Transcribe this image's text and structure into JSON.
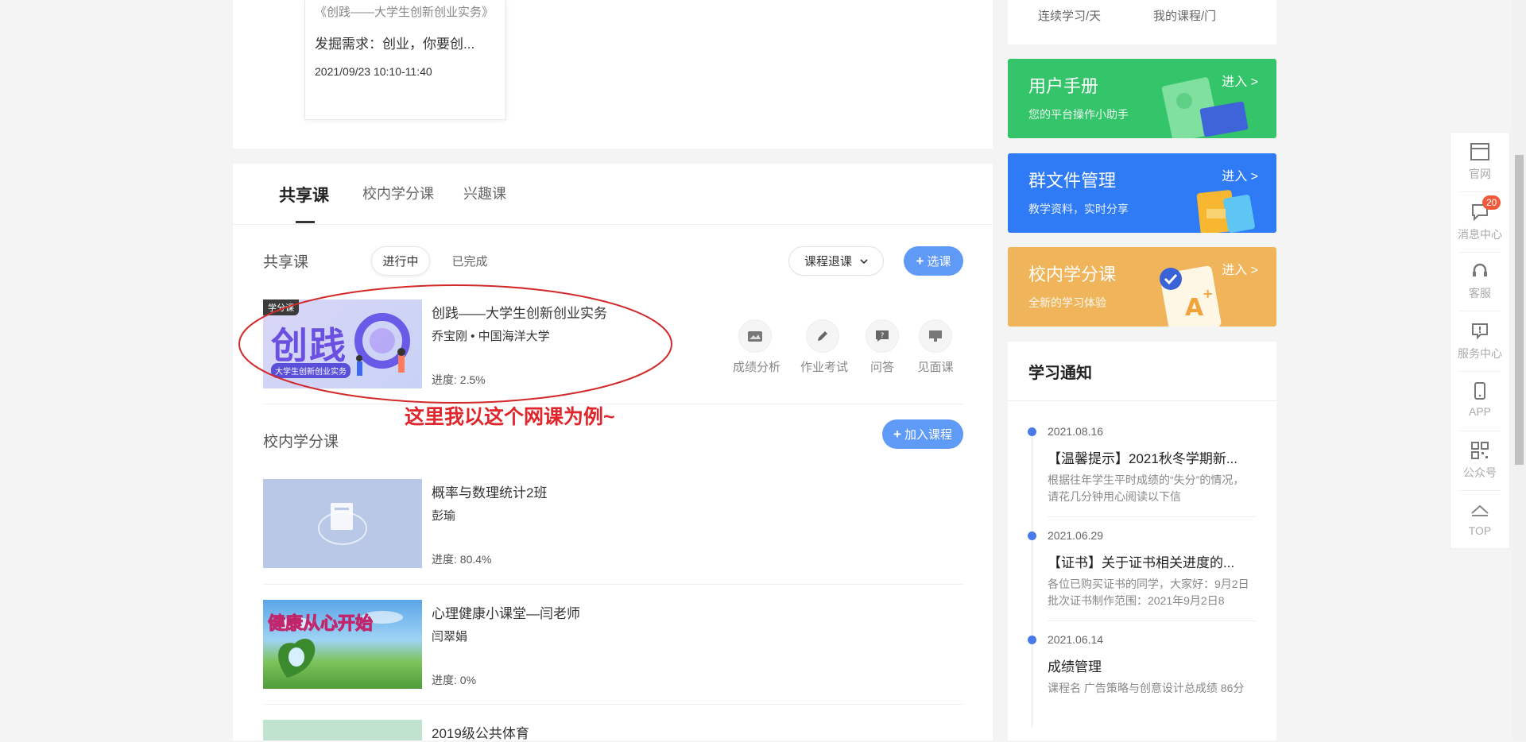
{
  "live_card": {
    "title": "《创践——大学生创新创业实务》",
    "desc": "发掘需求：创业，你要创...",
    "time": "2021/09/23 10:10-11:40"
  },
  "tabs": [
    "共享课",
    "校内学分课",
    "兴趣课"
  ],
  "shared": {
    "section_title": "共享课",
    "filter_active": "进行中",
    "filter_done": "已完成",
    "dropdown": "课程退课",
    "select_btn": "选课",
    "course": {
      "badge": "学分课",
      "thumb_text": "创践",
      "thumb_sub": "大学生创新创业实务",
      "name": "创践——大学生创新创业实务",
      "teacher": "乔宝刚 • 中国海洋大学",
      "progress": "进度: 2.5%"
    },
    "actions": [
      "成绩分析",
      "作业考试",
      "问答",
      "见面课"
    ],
    "annotation": "这里我以这个网课为例~"
  },
  "campus": {
    "section_title": "校内学分课",
    "add_btn": "加入课程",
    "courses": [
      {
        "name": "概率与数理统计2班",
        "teacher": "彭瑜",
        "progress": "进度: 80.4%"
      },
      {
        "name": "心理健康小课堂—闫老师",
        "teacher": "闫翠娟",
        "progress": "进度: 0%",
        "thumb_text": "健康从心开始"
      },
      {
        "name": "2019级公共体育"
      }
    ]
  },
  "stats": {
    "streak": "连续学习/天",
    "my_courses": "我的课程/门"
  },
  "promos": [
    {
      "title": "用户手册",
      "sub": "您的平台操作小助手",
      "enter": "进入 >",
      "color": "#34c46a"
    },
    {
      "title": "群文件管理",
      "sub": "教学资料，实时分享",
      "enter": "进入 >",
      "color": "#2f7bf5"
    },
    {
      "title": "校内学分课",
      "sub": "全新的学习体验",
      "enter": "进入 >",
      "color": "#f0b55a"
    }
  ],
  "notices": {
    "title": "学习通知",
    "items": [
      {
        "date": "2021.08.16",
        "head": "【温馨提示】2021秋冬学期新...",
        "body": "根据往年学生平时成绩的“失分”的情况，请花几分钟用心阅读以下信"
      },
      {
        "date": "2021.06.29",
        "head": "【证书】关于证书相关进度的...",
        "body": "各位已购买证书的同学，大家好：9月2日批次证书制作范围：2021年9月2日8"
      },
      {
        "date": "2021.06.14",
        "head": "成绩管理",
        "body": "课程名 广告策略与创意设计总成绩 86分"
      }
    ]
  },
  "sidebar": {
    "items": [
      {
        "label": "官网",
        "icon": "browser-icon"
      },
      {
        "label": "消息中心",
        "icon": "message-icon",
        "badge": "20"
      },
      {
        "label": "客服",
        "icon": "headset-icon"
      },
      {
        "label": "服务中心",
        "icon": "service-icon"
      },
      {
        "label": "APP",
        "icon": "phone-icon"
      },
      {
        "label": "公众号",
        "icon": "qrcode-icon"
      },
      {
        "label": "TOP",
        "icon": "top-arrow-icon"
      }
    ]
  }
}
